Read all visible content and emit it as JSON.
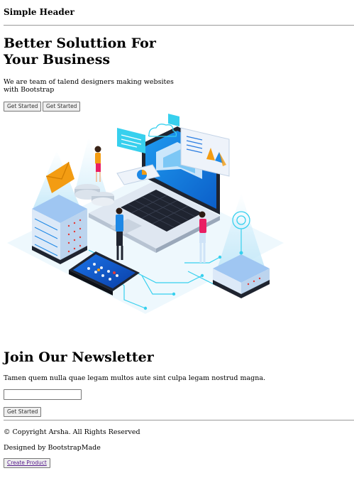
{
  "header": {
    "title": "Simple Header"
  },
  "hero": {
    "title": "Better Soluttion For Your Business",
    "subtitle": "We are team of talend designers making websites with Bootstrap",
    "buttons": [
      "Get Started",
      "Get Started"
    ]
  },
  "newsletter": {
    "title": "Join Our Newsletter",
    "subtitle": "Tamen quem nulla quae legam multos aute sint culpa legam nostrud magna.",
    "input_value": "",
    "button": "Get Started"
  },
  "footer": {
    "copyright": "© Copyright Arsha. All Rights Reserved",
    "designed_by": "Designed by BootstrapMade",
    "create_product": "Create Product"
  },
  "colors": {
    "primary_blue": "#1e88e5",
    "cyan": "#37d0ee",
    "dark": "#1f2430",
    "orange": "#f39c12"
  },
  "illustration": {
    "icon": "tech-isometric-illustration"
  }
}
